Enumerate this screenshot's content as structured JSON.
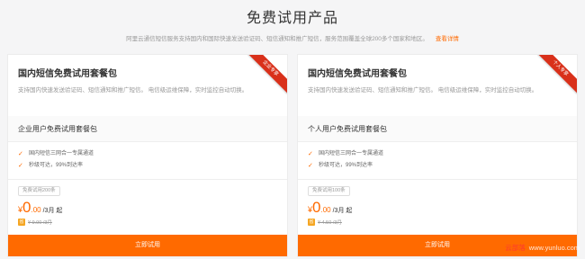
{
  "header": {
    "title": "免费试用产品",
    "subtitle": "阿里云通信短信服务支持国内和国际快速发送验证码、短信通知和推广短信，服务范围覆盖全球200多个国家和地区。",
    "more_link": "查看详情"
  },
  "cards": [
    {
      "ribbon": "企业专享",
      "title": "国内短信免费试用套餐包",
      "desc": "支持国内快速发送验证码、短信通知和推广短信。 电信级运维保障，实时监控自动切换。",
      "package_name": "企业用户免费试用套餐包",
      "features": [
        "国内短信三网合一专属通道",
        "秒级可达，99%到达率"
      ],
      "quota_badge": "免费试用200条",
      "price": {
        "currency": "¥",
        "integer": "0",
        "decimal": ".00",
        "unit": "/3月 起"
      },
      "orig_tag": "省",
      "orig_price": "¥ 9.00 /3月",
      "cta": "立即试用"
    },
    {
      "ribbon": "个人专享",
      "title": "国内短信免费试用套餐包",
      "desc": "支持国内快速发送验证码、短信通知和推广短信。 电信级运维保障，实时监控自动切换。",
      "package_name": "个人用户免费试用套餐包",
      "features": [
        "国内短信三网合一专属通道",
        "秒级可达，99%到达率"
      ],
      "quota_badge": "免费试用100条",
      "price": {
        "currency": "¥",
        "integer": "0",
        "decimal": ".00",
        "unit": "/3月 起"
      },
      "orig_tag": "省",
      "orig_price": "¥ 4.50 /3月",
      "cta": "立即试用"
    }
  ],
  "watermark": {
    "cn": "云部落",
    "url": "www.yunluo.com"
  },
  "colors": {
    "accent": "#ff6a00",
    "ribbon": "#d9301a",
    "text": "#333333",
    "muted": "#999999"
  }
}
